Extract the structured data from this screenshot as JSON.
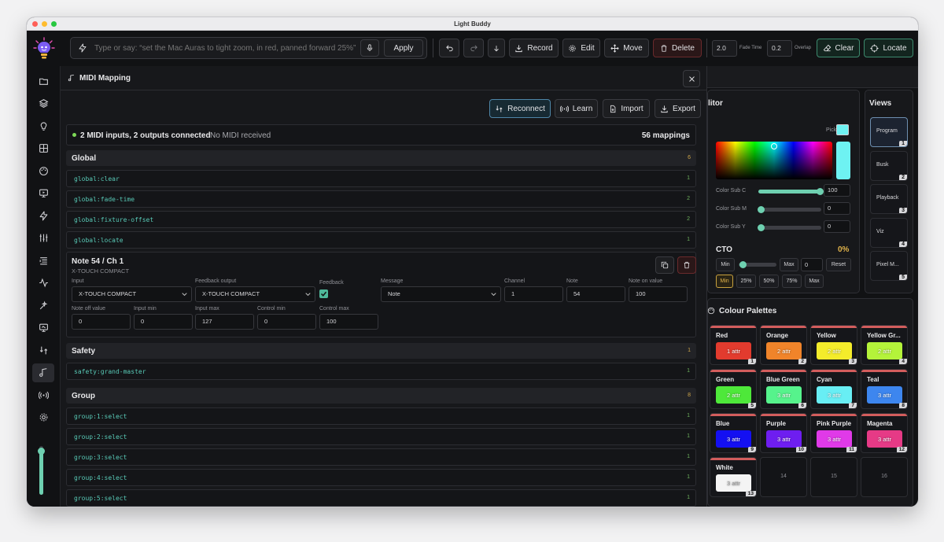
{
  "window": {
    "title": "Light Buddy"
  },
  "toolbar": {
    "command_placeholder": "Type or say: “set the Mac Auras to tight zoom, in red, panned forward 25%”",
    "apply": "Apply",
    "record": "Record",
    "edit": "Edit",
    "move": "Move",
    "delete": "Delete",
    "fade_time_value": "2.0",
    "fade_time_label": "Fade Time",
    "overlap_value": "0.2",
    "overlap_label": "Overlap",
    "clear": "Clear",
    "locate": "Locate"
  },
  "sidebar": {
    "icons": [
      "folder-icon",
      "layers-icon",
      "bulb-icon",
      "grid-icon",
      "palette-icon",
      "monitor-icon",
      "bolt-icon",
      "sliders-icon",
      "list-icon",
      "activity-icon",
      "wand-icon",
      "screen-icon",
      "mapping-icon",
      "music-note-icon",
      "broadcast-icon",
      "gear-icon"
    ],
    "active_index": 13,
    "master_level": 0.9
  },
  "midi": {
    "title": "MIDI Mapping",
    "reconnect": "Reconnect",
    "learn": "Learn",
    "import": "Import",
    "export": "Export",
    "status_main": "2 MIDI inputs, 2 outputs connected",
    "status_sub": "No MIDI received",
    "mappings_count": "56 mappings",
    "global": {
      "title": "Global",
      "count": "6",
      "rows": [
        {
          "key": "global:clear",
          "count": "1"
        },
        {
          "key": "global:fade-time",
          "count": "2"
        },
        {
          "key": "global:fixture-offset",
          "count": "2"
        },
        {
          "key": "global:locate",
          "count": "1"
        }
      ]
    },
    "editor": {
      "title": "Note 54 / Ch 1",
      "device": "X-TOUCH COMPACT",
      "input_label": "Input",
      "input_value": "X-TOUCH COMPACT",
      "feedback_output_label": "Feedback output",
      "feedback_output_value": "X-TOUCH COMPACT",
      "feedback_label": "Feedback",
      "message_label": "Message",
      "message_value": "Note",
      "channel_label": "Channel",
      "channel_value": "1",
      "note_label": "Note",
      "note_value": "54",
      "note_on_label": "Note on value",
      "note_on_value": "100",
      "note_off_label": "Note off value",
      "note_off_value": "0",
      "input_min_label": "Input min",
      "input_min_value": "0",
      "input_max_label": "Input max",
      "input_max_value": "127",
      "control_min_label": "Control min",
      "control_min_value": "0",
      "control_max_label": "Control max",
      "control_max_value": "100"
    },
    "safety": {
      "title": "Safety",
      "count": "1",
      "rows": [
        {
          "key": "safety:grand-master",
          "count": "1"
        }
      ]
    },
    "group": {
      "title": "Group",
      "count": "8",
      "rows": [
        {
          "key": "group:1:select",
          "count": "1"
        },
        {
          "key": "group:2:select",
          "count": "1"
        },
        {
          "key": "group:3:select",
          "count": "1"
        },
        {
          "key": "group:4:select",
          "count": "1"
        },
        {
          "key": "group:5:select",
          "count": "1"
        }
      ]
    }
  },
  "color_editor": {
    "title_fragment": "litor",
    "pick_label": "Pick",
    "pick_color": "#6ef2f2",
    "sub_c_label": "Color Sub C",
    "sub_c_value": "100",
    "sub_m_label": "Color Sub M",
    "sub_m_value": "0",
    "sub_y_label": "Color Sub Y",
    "sub_y_value": "0",
    "cto_label": "CTO",
    "cto_value": "0%",
    "min": "Min",
    "max": "Max",
    "max_value": "0",
    "reset": "Reset",
    "presets": [
      "Min",
      "25%",
      "50%",
      "75%",
      "Max"
    ]
  },
  "views": {
    "title": "Views",
    "items": [
      {
        "label": "Program",
        "num": "1"
      },
      {
        "label": "Busk",
        "num": "2"
      },
      {
        "label": "Playback",
        "num": "3"
      },
      {
        "label": "Viz",
        "num": "4"
      },
      {
        "label": "Pixel M...",
        "num": "5"
      }
    ]
  },
  "palettes": {
    "title": "Colour Palettes",
    "items": [
      {
        "name": "Red",
        "attr": "1 attr",
        "num": "1",
        "color": "#e23b2e"
      },
      {
        "name": "Orange",
        "attr": "2 attr",
        "num": "2",
        "color": "#f0842a"
      },
      {
        "name": "Yellow",
        "attr": "2 attr",
        "num": "3",
        "color": "#f4ec2b"
      },
      {
        "name": "Yellow Gr...",
        "attr": "2 attr",
        "num": "4",
        "color": "#b4f33a"
      },
      {
        "name": "Green",
        "attr": "2 attr",
        "num": "5",
        "color": "#4ee83a"
      },
      {
        "name": "Blue Green",
        "attr": "3 attr",
        "num": "6",
        "color": "#56f38c"
      },
      {
        "name": "Cyan",
        "attr": "3 attr",
        "num": "7",
        "color": "#68eef4"
      },
      {
        "name": "Teal",
        "attr": "3 attr",
        "num": "8",
        "color": "#3d86ef"
      },
      {
        "name": "Blue",
        "attr": "3 attr",
        "num": "9",
        "color": "#1410f2"
      },
      {
        "name": "Purple",
        "attr": "3 attr",
        "num": "10",
        "color": "#6e1ef0"
      },
      {
        "name": "Pink Purple",
        "attr": "3 attr",
        "num": "11",
        "color": "#e03ae8"
      },
      {
        "name": "Magenta",
        "attr": "3 attr",
        "num": "12",
        "color": "#e63a86"
      },
      {
        "name": "White",
        "attr": "3 attr",
        "num": "13",
        "color": "#f4f4f4"
      },
      {
        "name": "",
        "attr": "",
        "num": "14",
        "color": ""
      },
      {
        "name": "",
        "attr": "",
        "num": "15",
        "color": ""
      },
      {
        "name": "",
        "attr": "",
        "num": "16",
        "color": ""
      }
    ]
  }
}
